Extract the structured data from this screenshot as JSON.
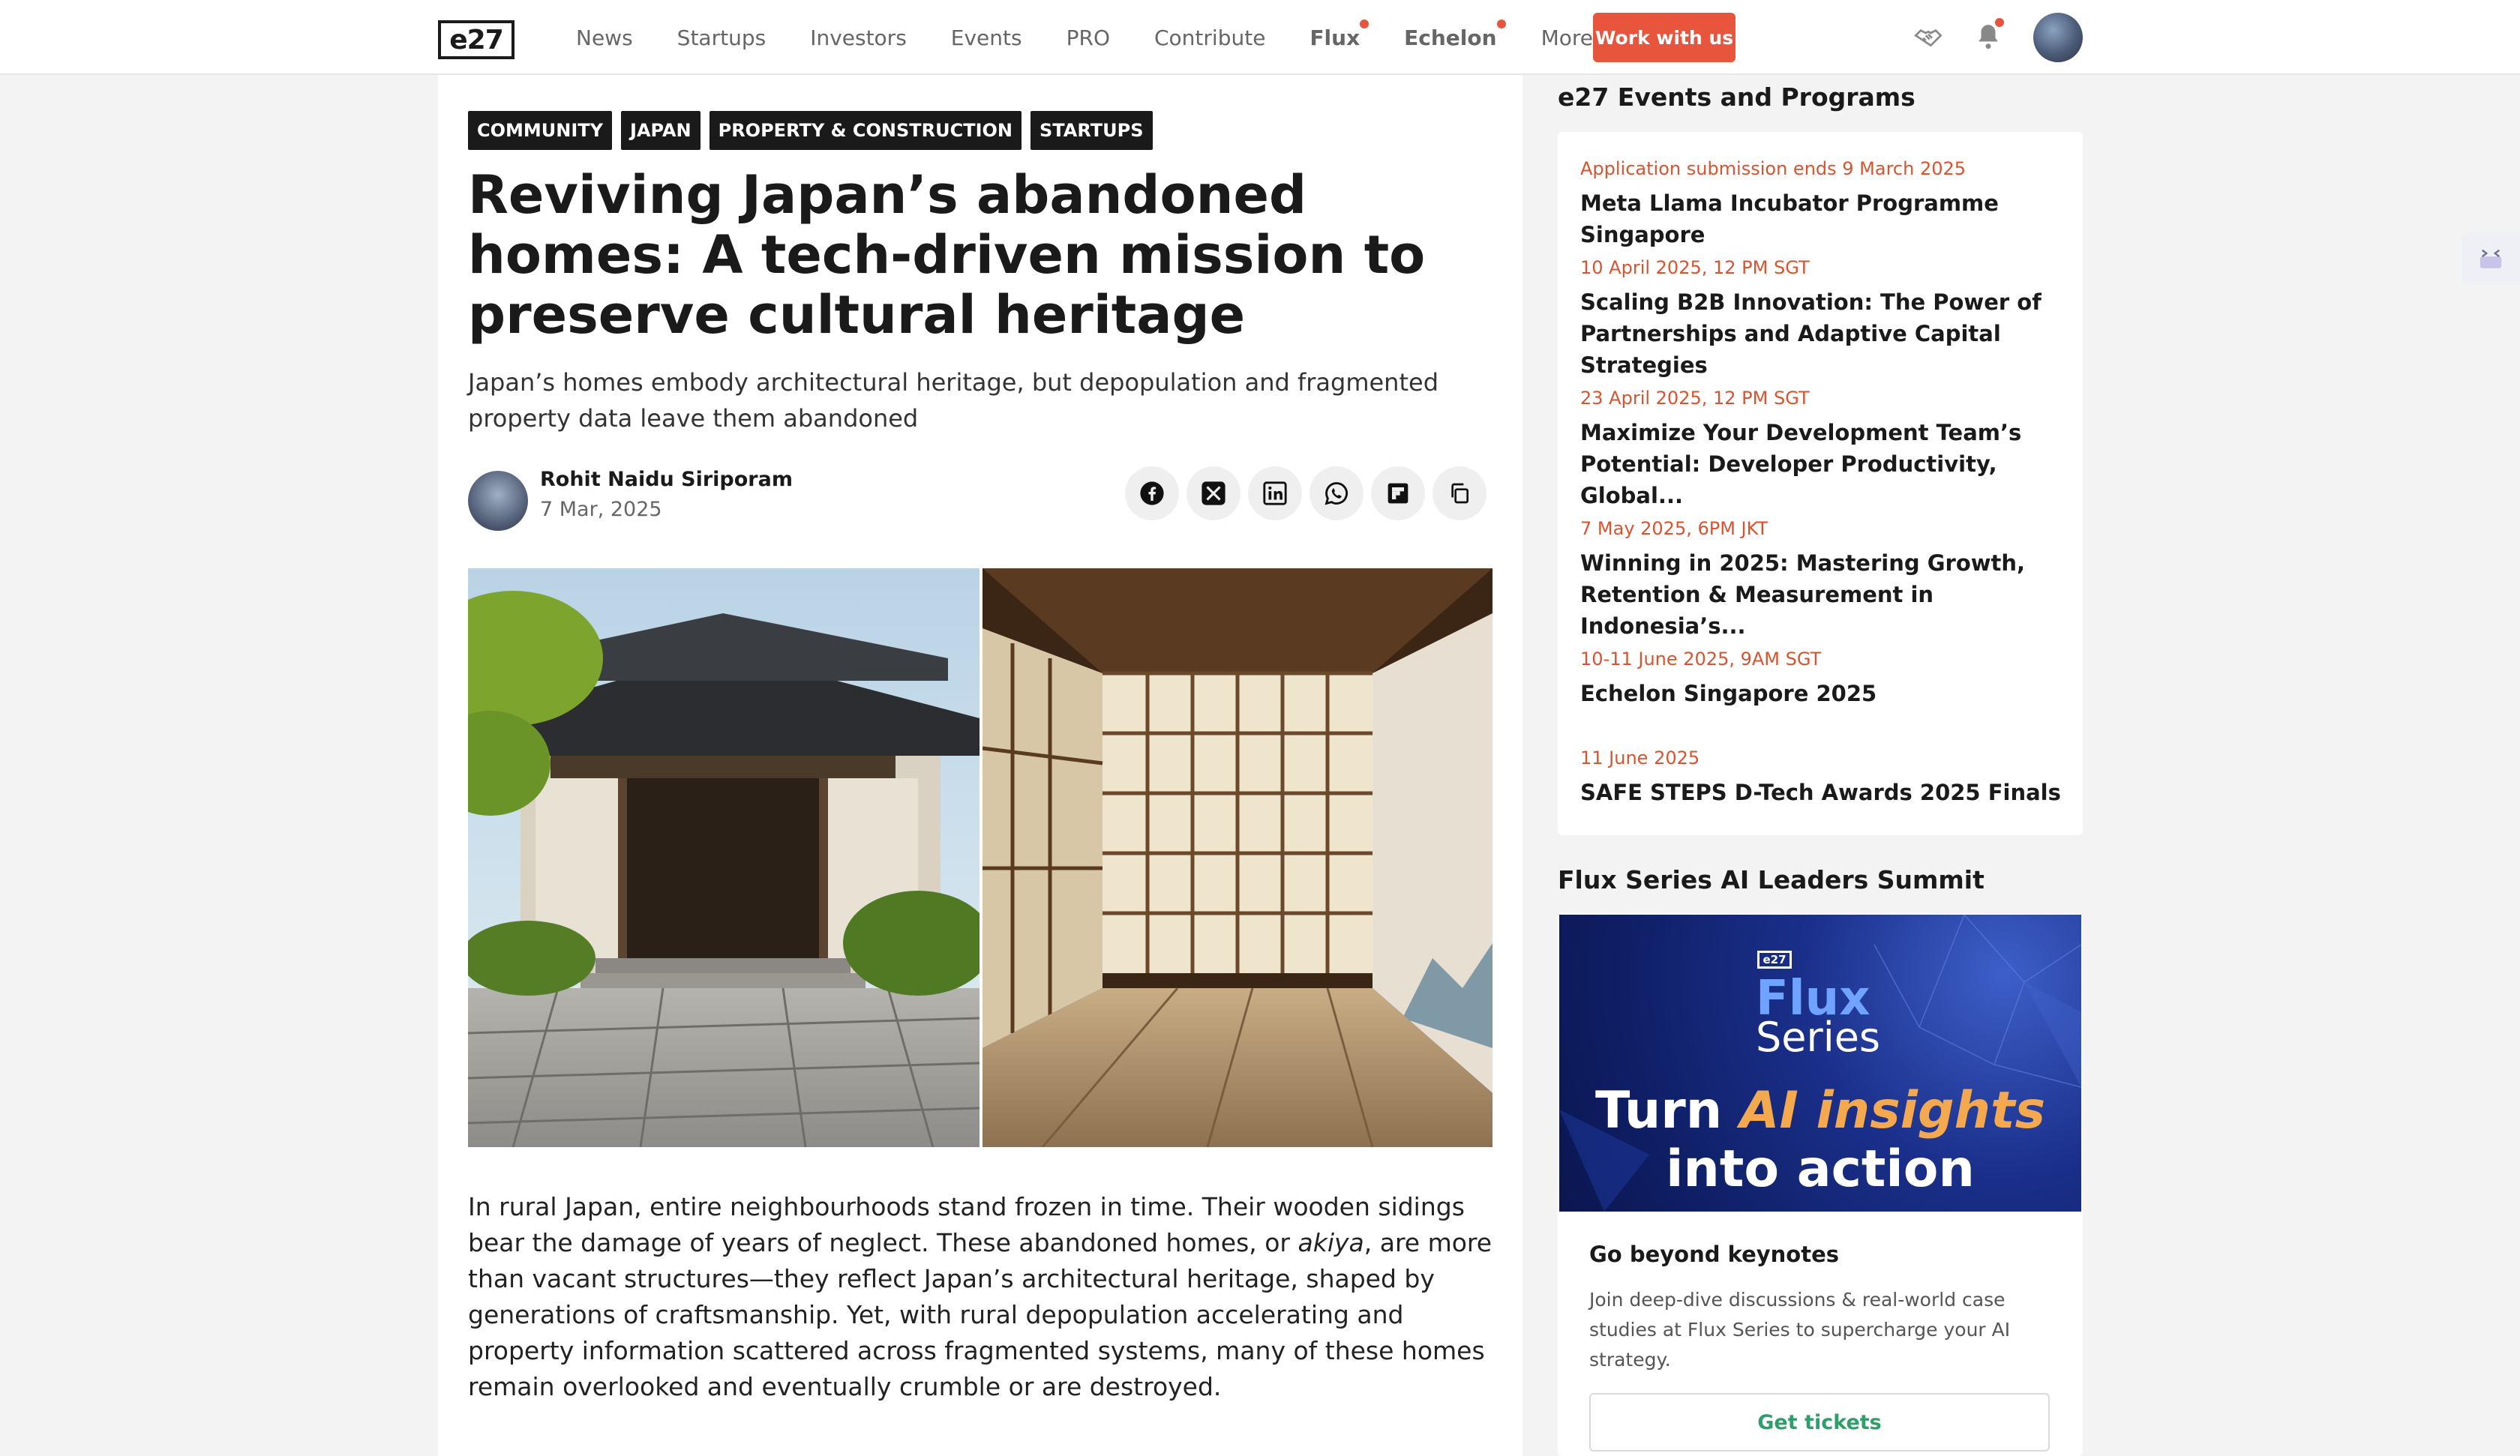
{
  "nav": {
    "logo": "e27",
    "links": [
      "News",
      "Startups",
      "Investors",
      "Events",
      "PRO",
      "Contribute",
      "Flux",
      "Echelon",
      "More"
    ],
    "cta": "Work with us",
    "accent_color": "#e8553d"
  },
  "article": {
    "tags": [
      "COMMUNITY",
      "JAPAN",
      "PROPERTY & CONSTRUCTION",
      "STARTUPS"
    ],
    "title": "Reviving Japan’s abandoned homes: A tech-driven mission to preserve cultural heritage",
    "subtitle": "Japan’s homes embody architectural heritage, but depopulation and fragmented property data leave them abandoned",
    "author": "Rohit Naidu Siriporam",
    "date": "7 Mar, 2025",
    "share_icons": [
      "facebook-icon",
      "x-icon",
      "linkedin-icon",
      "whatsapp-icon",
      "flipboard-icon",
      "copy-icon"
    ],
    "body_before": "In rural Japan, entire neighbourhoods stand frozen in time. Their wooden sidings bear the damage of years of neglect. These abandoned homes, or ",
    "body_italic": "akiya",
    "body_after": ", are more than vacant structures—they reflect Japan’s architectural heritage, shaped by generations of craftsmanship. Yet, with rural depopulation accelerating and property information scattered across fragmented systems, many of these homes remain overlooked and eventually crumble or are destroyed."
  },
  "sidebar": {
    "events_heading": "e27 Events and Programs",
    "events": [
      {
        "date": "Application submission ends 9 March 2025",
        "title": "Meta Llama Incubator Programme Singapore"
      },
      {
        "date": "10 April 2025, 12 PM SGT",
        "title": "Scaling B2B Innovation: The Power of Partnerships and Adaptive Capital Strategies"
      },
      {
        "date": "23 April 2025, 12 PM SGT",
        "title": "Maximize Your Development Team’s Potential: Developer Productivity, Global..."
      },
      {
        "date": "7 May 2025, 6PM JKT",
        "title": "Winning in 2025: Mastering Growth, Retention & Measurement in Indonesia’s..."
      },
      {
        "date": "10-11 June 2025, 9AM SGT",
        "title": "Echelon Singapore 2025"
      },
      {
        "date": "11 June 2025",
        "title": "SAFE STEPS D-Tech Awards 2025 Finals"
      }
    ],
    "flux_heading": "Flux Series AI Leaders Summit",
    "flux_banner": {
      "logo": "e27",
      "flux": "Flux",
      "series": "Series",
      "line1_pre": "Turn ",
      "line1_accent": "AI insights",
      "line2": "into action"
    },
    "flux_sub": "Go beyond keynotes",
    "flux_desc": "Join deep-dive discussions & real-world case studies at Flux Series to supercharge your AI strategy.",
    "tickets": "Get tickets",
    "date_color": "#d9532f"
  }
}
